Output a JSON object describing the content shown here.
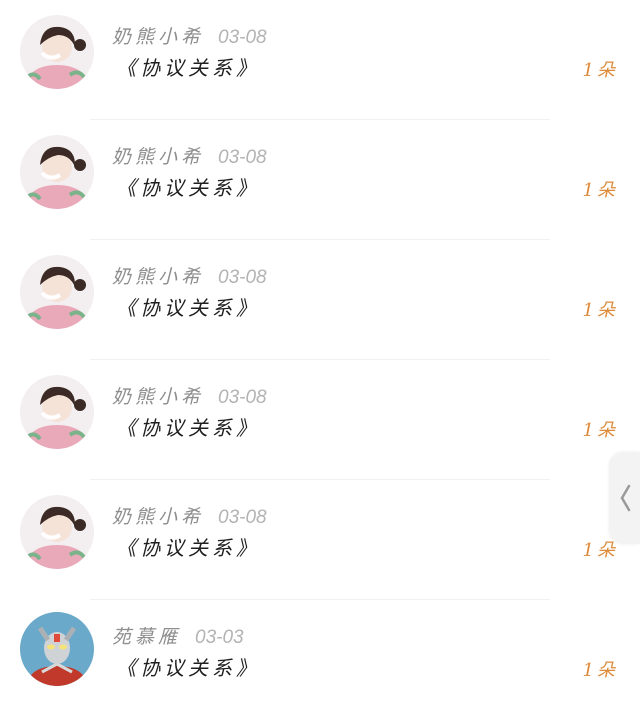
{
  "items": [
    {
      "name": "奶熊小希",
      "date": "03-08",
      "title": "《协议关系》",
      "count": "1朵",
      "avatar": "girl-avatar"
    },
    {
      "name": "奶熊小希",
      "date": "03-08",
      "title": "《协议关系》",
      "count": "1朵",
      "avatar": "girl-avatar"
    },
    {
      "name": "奶熊小希",
      "date": "03-08",
      "title": "《协议关系》",
      "count": "1朵",
      "avatar": "girl-avatar"
    },
    {
      "name": "奶熊小希",
      "date": "03-08",
      "title": "《协议关系》",
      "count": "1朵",
      "avatar": "girl-avatar"
    },
    {
      "name": "奶熊小希",
      "date": "03-08",
      "title": "《协议关系》",
      "count": "1朵",
      "avatar": "girl-avatar"
    },
    {
      "name": "苑慕雁",
      "date": "03-03",
      "title": "《协议关系》",
      "count": "1朵",
      "avatar": "ultraman-avatar"
    }
  ],
  "side_tab": {
    "icon": "chevron-left-icon"
  },
  "colors": {
    "count": "#de8a3a",
    "name": "#8e8e8e",
    "date": "#b3b3b3",
    "title": "#1f1f1f"
  }
}
